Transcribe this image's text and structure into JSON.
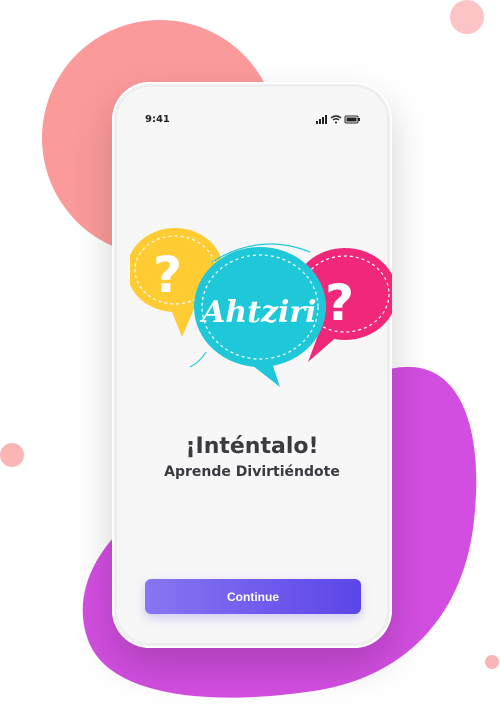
{
  "status_bar": {
    "time": "9:41"
  },
  "logo": {
    "brand_text": "Ahtziri",
    "question_mark": "?",
    "colors": {
      "yellow": "#ffcc33",
      "cyan": "#1ec8d8",
      "pink": "#f0287a"
    }
  },
  "main": {
    "title": "¡Inténtalo!",
    "subtitle": "Aprende Divirtiéndote"
  },
  "actions": {
    "continue_label": "Continue"
  },
  "theme": {
    "accent": "#6b57ee",
    "blob_salmon": "#fb9a9a",
    "blob_purple": "#d24ee0",
    "background": "#ffffff"
  }
}
